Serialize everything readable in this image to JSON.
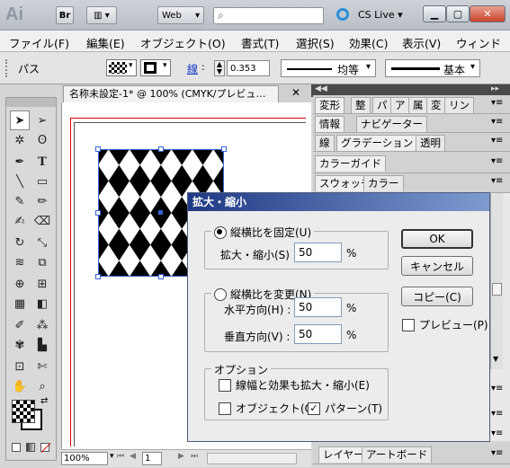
{
  "titlebar": {
    "app_logo": "Ai",
    "bridge": "Br",
    "workspace": "Web",
    "cslive": "CS Live"
  },
  "menubar": [
    "ファイル(F)",
    "編集(E)",
    "オブジェクト(O)",
    "書式(T)",
    "選択(S)",
    "効果(C)",
    "表示(V)",
    "ウィンド"
  ],
  "controlbar": {
    "selection_label": "パス",
    "stroke_label": "線",
    "stroke_value": "0.353",
    "profile_label": "均等",
    "brush_label": "基本"
  },
  "document": {
    "tab_title": "名称未設定-1* @ 100% (CMYK/プレビュ…",
    "zoom": "100%",
    "page": "1"
  },
  "panels": {
    "row1": [
      "変形",
      "整",
      "パ",
      "ア",
      "属",
      "変",
      "リン"
    ],
    "row2": [
      "情報",
      "ナビゲーター"
    ],
    "row3": [
      "線",
      "グラデーション",
      "透明"
    ],
    "row4": [
      "カラーガイド"
    ],
    "row5": [
      "スウォッチ",
      "カラー"
    ],
    "bottom": [
      "レイヤー",
      "アートボード"
    ]
  },
  "dialog": {
    "title": "拡大・縮小",
    "uniform_label": "縦横比を固定(U)",
    "scale_label": "拡大・縮小(S) :",
    "scale_value": "50",
    "nonuniform_label": "縦横比を変更(N)",
    "horizontal_label": "水平方向(H) :",
    "horizontal_value": "50",
    "vertical_label": "垂直方向(V) :",
    "vertical_value": "50",
    "percent": "%",
    "options_label": "オプション",
    "scale_strokes_label": "線幅と効果も拡大・縮小(E)",
    "objects_label": "オブジェクト(O)",
    "patterns_label": "パターン(T)",
    "ok": "OK",
    "cancel": "キャンセル",
    "copy": "コピー(C)",
    "preview": "プレビュー(P)"
  },
  "colors": {
    "title_gradient_start": "#1f3a84",
    "title_gradient_end": "#7e9bd0",
    "selection_blue": "#3a63d6"
  }
}
